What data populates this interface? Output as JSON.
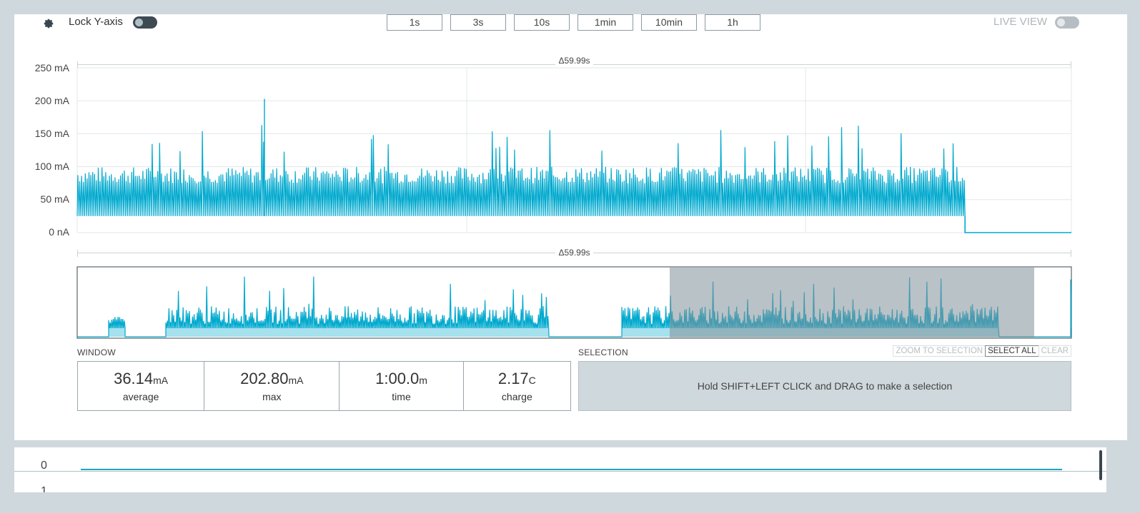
{
  "toolbar": {
    "lock_y_label": "Lock Y-axis",
    "live_view_label": "LIVE VIEW",
    "zoom_buttons": [
      "1s",
      "3s",
      "10s",
      "1min",
      "10min",
      "1h"
    ]
  },
  "chart": {
    "delta_top": "Δ59.99s",
    "delta_bottom": "Δ59.99s",
    "y_ticks": [
      "250 mA",
      "200 mA",
      "150 mA",
      "100 mA",
      "50 mA",
      "0 nA"
    ]
  },
  "chart_data": {
    "type": "line",
    "ylim": [
      0,
      250
    ],
    "yticks": [
      0,
      50,
      100,
      150,
      200,
      250
    ],
    "grid": true,
    "series": [
      {
        "baseline": 25,
        "typical_peak": 90,
        "max": 202.8,
        "drop_to_zero_fraction": 0.893
      }
    ],
    "color": "#00a9ce"
  },
  "window": {
    "label": "WINDOW",
    "stats": [
      {
        "value": "36.14",
        "unit": "mA",
        "caption": "average"
      },
      {
        "value": "202.80",
        "unit": "mA",
        "caption": "max"
      },
      {
        "value": "1:00.0",
        "unit": "m",
        "caption": "time"
      },
      {
        "value": "2.17",
        "unit": "C",
        "caption": "charge"
      }
    ]
  },
  "selection": {
    "label": "SELECTION",
    "zoom_to_selection": "ZOOM TO SELECTION",
    "select_all": "SELECT ALL",
    "clear": "CLEAR",
    "hint": "Hold SHIFT+LEFT CLICK and DRAG to make a selection"
  },
  "digital_channels": [
    "0",
    "1"
  ],
  "colors": {
    "accent": "#00a9ce",
    "background": "#cfd8dc"
  }
}
